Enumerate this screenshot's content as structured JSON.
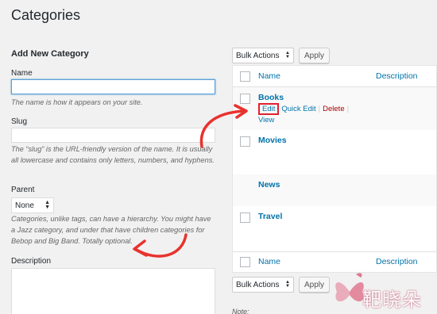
{
  "page": {
    "title": "Categories"
  },
  "form": {
    "section_title": "Add New Category",
    "name": {
      "label": "Name",
      "value": "",
      "hint": "The name is how it appears on your site."
    },
    "slug": {
      "label": "Slug",
      "value": "",
      "hint": "The “slug” is the URL-friendly version of the name. It is usually all lowercase and contains only letters, numbers, and hyphens."
    },
    "parent": {
      "label": "Parent",
      "selected": "None",
      "hint": "Categories, unlike tags, can have a hierarchy. You might have a Jazz category, and under that have children categories for Bebop and Big Band. Totally optional."
    },
    "description": {
      "label": "Description",
      "value": ""
    }
  },
  "list": {
    "bulk_actions_label": "Bulk Actions",
    "apply_label": "Apply",
    "columns": {
      "name": "Name",
      "description": "Description"
    },
    "rows": [
      {
        "name": "Books",
        "actions": {
          "edit": "Edit",
          "quick_edit": "Quick Edit",
          "delete": "Delete",
          "view": "View"
        }
      },
      {
        "name": "Movies"
      },
      {
        "name": "News"
      },
      {
        "name": "Travel"
      }
    ],
    "note": "Note:"
  },
  "colors": {
    "link": "#0073aa",
    "delete": "#aa0000",
    "highlight": "#e0202e",
    "arrow": "#e8322e"
  },
  "icons": {
    "select": "chevron-updown-icon",
    "arrow": "curved-arrow-icon",
    "logo": "butterfly-logo"
  },
  "watermark": {
    "text": "靶晓朵"
  }
}
